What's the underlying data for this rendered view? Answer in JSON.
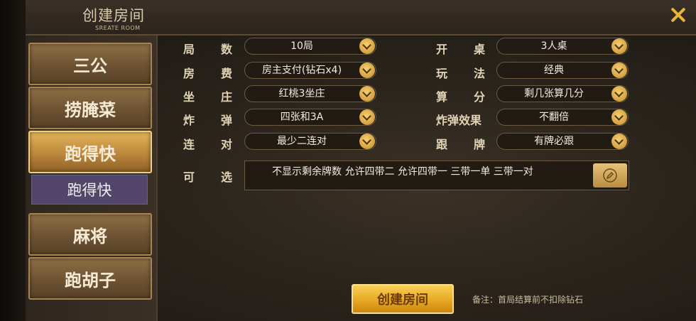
{
  "header": {
    "title": "创建房间",
    "subtitle": "SREATE ROOM",
    "close_icon": "close-icon"
  },
  "sidebar": {
    "items": [
      {
        "label": "三公",
        "active": false
      },
      {
        "label": "捞腌菜",
        "active": false
      },
      {
        "label": "跑得快",
        "active": true
      },
      {
        "label": "麻将",
        "active": false
      },
      {
        "label": "跑胡子",
        "active": false
      }
    ],
    "sub_items": [
      {
        "label": "跑得快"
      }
    ]
  },
  "form": {
    "left": [
      {
        "label_a": "局",
        "label_b": "数",
        "value": "10局"
      },
      {
        "label_a": "房",
        "label_b": "费",
        "value": "房主支付(钻石x4)"
      },
      {
        "label_a": "坐",
        "label_b": "庄",
        "value": "红桃3坐庄"
      },
      {
        "label_a": "炸",
        "label_b": "弹",
        "value": "四张和3A"
      },
      {
        "label_a": "连",
        "label_b": "对",
        "value": "最少二连对"
      }
    ],
    "right": [
      {
        "label_a": "开",
        "label_b": "桌",
        "value": "3人桌"
      },
      {
        "label_a": "玩",
        "label_b": "法",
        "value": "经典"
      },
      {
        "label_a": "算",
        "label_b": "分",
        "value": "剩几张算几分"
      },
      {
        "label": "炸弹效果",
        "value": "不翻倍"
      },
      {
        "label_a": "跟",
        "label_b": "牌",
        "value": "有牌必跟"
      }
    ],
    "optional": {
      "label_a": "可",
      "label_b": "选",
      "value": "不显示剩余牌数 允许四带二 允许四带一 三带一单 三带一对",
      "edit_icon": "pencil-icon"
    }
  },
  "footer": {
    "create_label": "创建房间",
    "note": "备注：首局结算前不扣除钻石"
  },
  "colors": {
    "accent_gold": "#e9a923",
    "label": "#e1d3b3",
    "sub_item_bg": "#52476a"
  }
}
